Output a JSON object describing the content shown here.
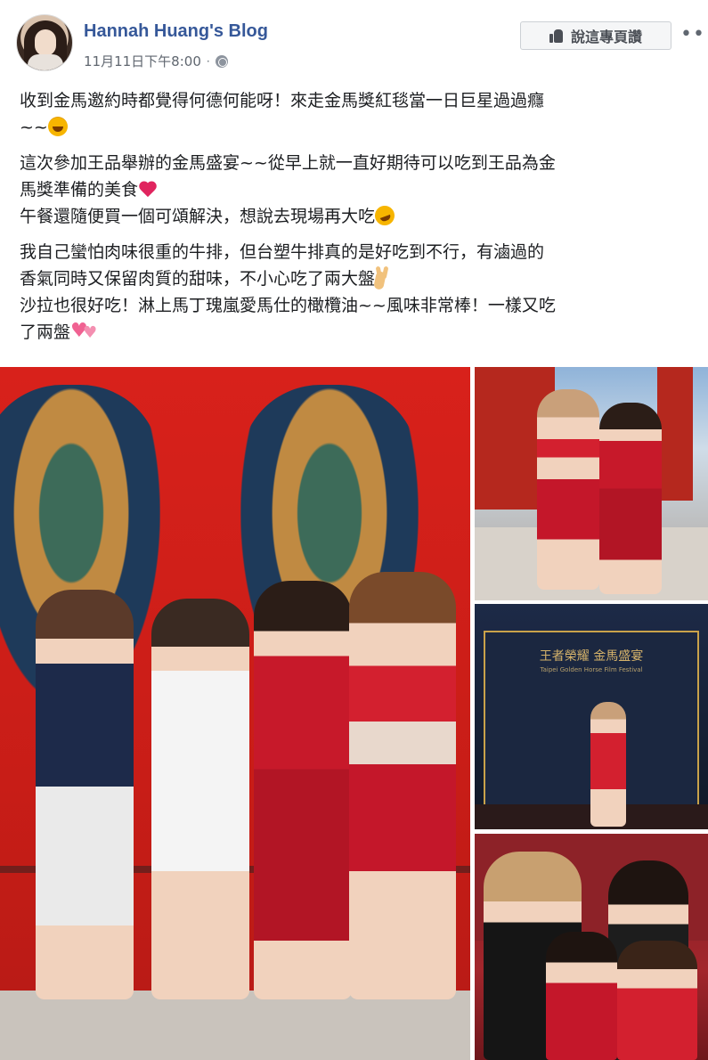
{
  "header": {
    "page_name": "Hannah Huang's Blog",
    "timestamp": "11月11日下午8:00",
    "separator": "·",
    "privacy_icon": "globe-icon",
    "like_button_label": "說這專頁讚",
    "like_button_icon": "thumbs-up-icon",
    "more_icon": "more-options-icon",
    "link_color": "#365899"
  },
  "post": {
    "paragraphs": [
      {
        "lines": [
          "收到金馬邀約時都覺得何德何能呀！來走金馬獎紅毯當一日巨星過過癮",
          "~~"
        ],
        "trailing_emoji": "laughing-emoji"
      },
      {
        "lines": [
          "這次參加王品舉辦的金馬盛宴~~從早上就一直好期待可以吃到王品為金",
          "馬獎準備的美食",
          "午餐還隨便買一個可頌解決，想說去現場再大吃"
        ],
        "emojis": [
          "heart-emoji",
          "rofl-emoji"
        ]
      },
      {
        "lines": [
          "我自己蠻怕肉味很重的牛排，但台塑牛排真的是好吃到不行，有滷過的",
          "香氣同時又保留肉質的甜味，不小心吃了兩大盤",
          "沙拉也很好吃！淋上馬丁瑰嵐愛馬仕的橄欖油~~風味非常棒！一樣又吃",
          "了兩盤"
        ],
        "emojis": [
          "victory-hand-emoji",
          "two-hearts-emoji"
        ]
      }
    ]
  },
  "photos": {
    "backdrop_title": "王者榮耀 金馬盛宴",
    "backdrop_subtitle": "Taipei Golden Horse Film Festival"
  }
}
